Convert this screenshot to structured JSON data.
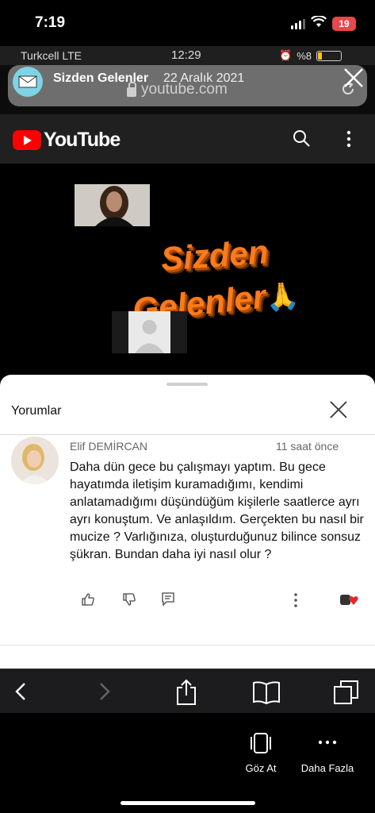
{
  "status_bar": {
    "time": "7:19",
    "battery": "19"
  },
  "inner_status": {
    "carrier": "Turkcell LTE",
    "time": "12:29",
    "battery": "%8"
  },
  "notification": {
    "title": "Sizden Gelenler",
    "date": "22 Aralık 2021",
    "url": "youtube.com"
  },
  "youtube": {
    "logo_text": "YouTube"
  },
  "video": {
    "title_line1": "Sizden",
    "title_line2": "Gelenler",
    "emoji": "🙏"
  },
  "comments": {
    "header": "Yorumlar",
    "items": [
      {
        "author": "Elif DEMİRCAN",
        "time": "11 saat önce",
        "text": "Daha dün gece bu çalışmayı yaptım. Bu gece hayatımda iletişim kuramadığımı, kendimi anlatamadığımı düşündüğüm kişilerle saatlerce ayrı ayrı konuştum. Ve anlaşıldım. Gerçekten bu nasıl bir mucize ? Varlığınıza, oluşturduğunuz bilince sonsuz şükran. Bundan daha iyi nasıl olur ?"
      }
    ]
  },
  "share_actions": {
    "view_label": "Göz At",
    "more_label": "Daha Fazla"
  },
  "colors": {
    "youtube_red": "#ff0000",
    "title_orange": "#ff7a1a",
    "battery_red": "#e5484d"
  }
}
